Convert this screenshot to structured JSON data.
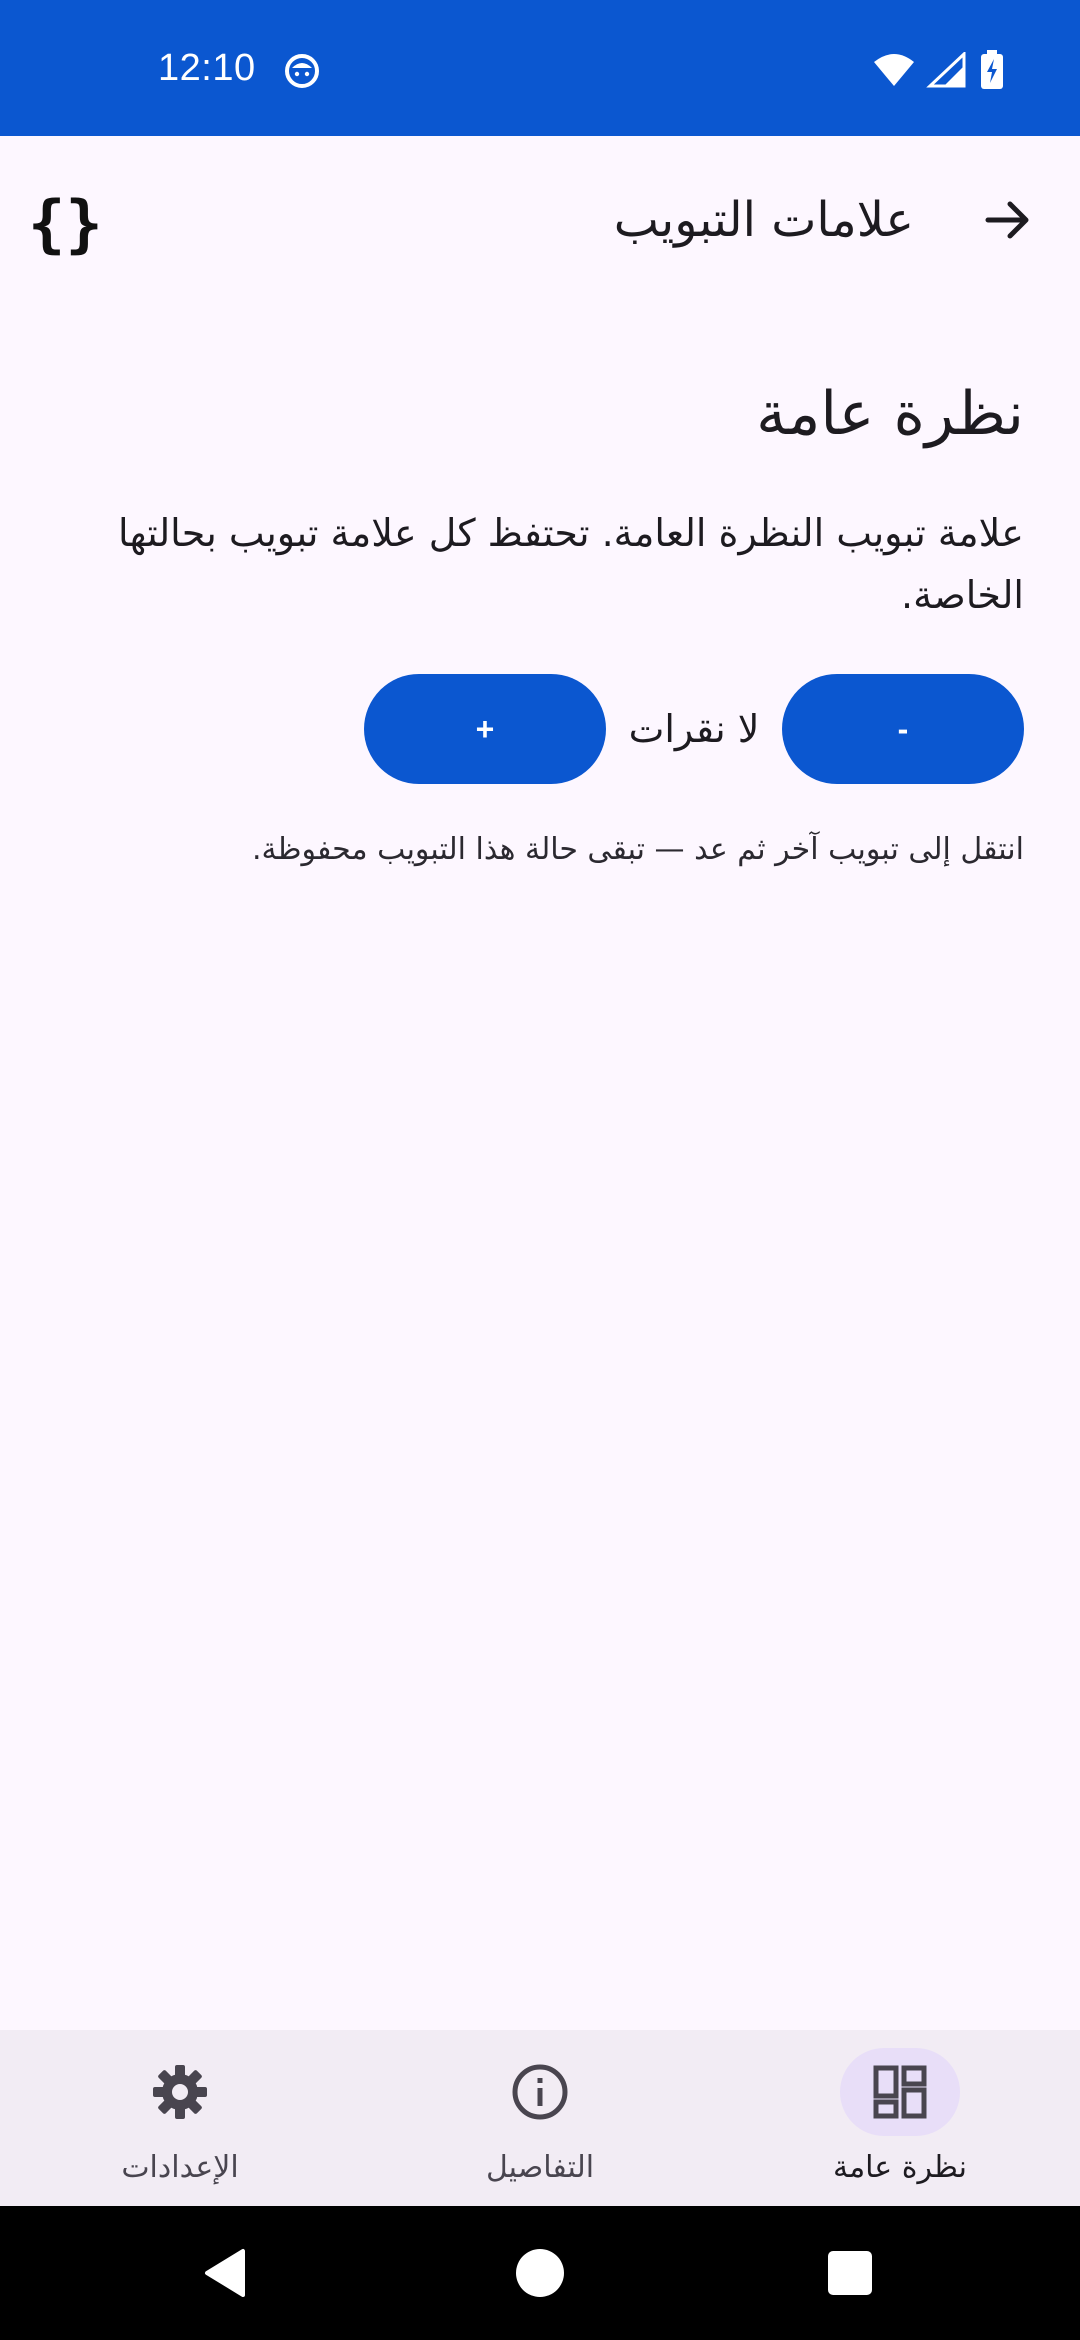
{
  "status_bar": {
    "time": "12:10",
    "background": "#0b57d0"
  },
  "app_bar": {
    "title": "علامات التبويب",
    "braces_text": "{}",
    "back_icon": "arrow-right-icon"
  },
  "main": {
    "heading": "نظرة عامة",
    "description": "علامة تبويب النظرة العامة. تحتفظ كل علامة تبويب بحالتها الخاصة.",
    "counter": {
      "minus_label": "-",
      "plus_label": "+",
      "value_label": "لا نقرات"
    },
    "hint": "انتقل إلى تبويب آخر ثم عد — تبقى حالة هذا التبويب محفوظة."
  },
  "bottom_nav": {
    "items": [
      {
        "label": "نظرة عامة",
        "icon": "dashboard-icon",
        "active": true
      },
      {
        "label": "التفاصيل",
        "icon": "info-icon",
        "active": false
      },
      {
        "label": "الإعدادات",
        "icon": "gear-icon",
        "active": false
      }
    ]
  },
  "colors": {
    "accent": "#0b57d0",
    "background": "#fdf7ff",
    "nav_background": "#f2ecf4",
    "active_indicator": "#e8def8"
  }
}
